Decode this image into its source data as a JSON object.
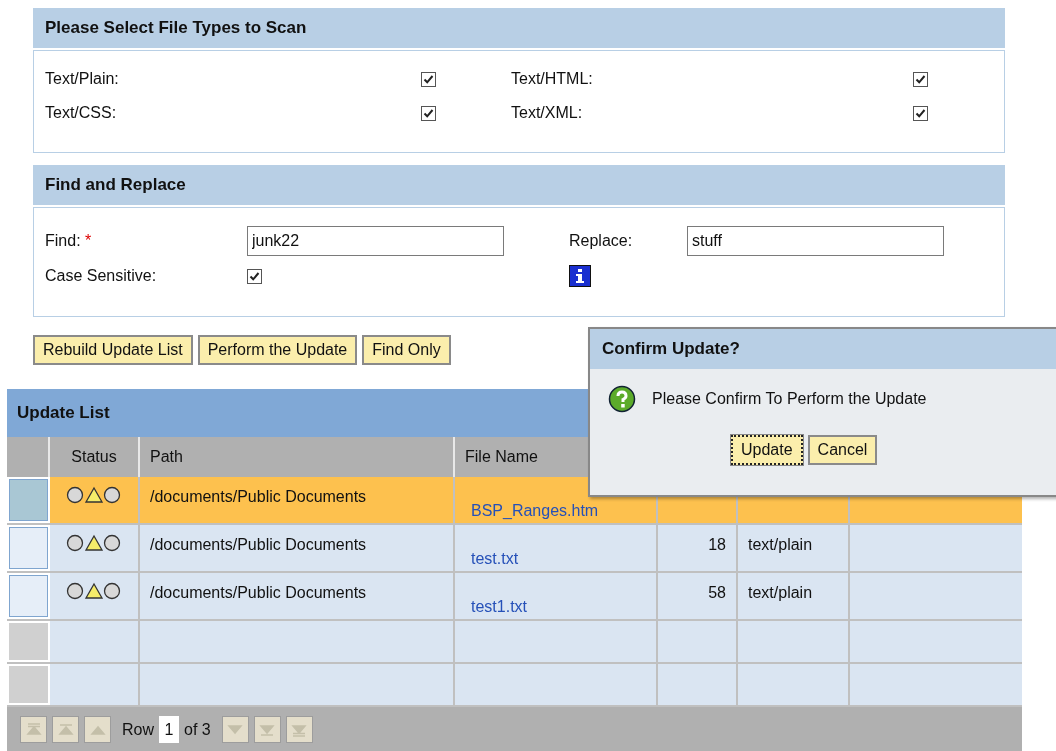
{
  "file_types": {
    "title": "Please Select File Types to Scan",
    "items": [
      {
        "label": "Text/Plain:",
        "checked": true
      },
      {
        "label": "Text/HTML:",
        "checked": true
      },
      {
        "label": "Text/CSS:",
        "checked": true
      },
      {
        "label": "Text/XML:",
        "checked": true
      }
    ]
  },
  "find_replace": {
    "title": "Find and Replace",
    "find_label": "Find:",
    "required_mark": "*",
    "find_value": "junk22",
    "replace_label": "Replace:",
    "replace_value": "stuff",
    "case_label": "Case Sensitive:",
    "case_checked": true
  },
  "actions": [
    "Rebuild Update List",
    "Perform the Update",
    "Find Only"
  ],
  "update_list": {
    "title": "Update List",
    "columns": [
      "Status",
      "Path",
      "File Name"
    ],
    "rows": [
      {
        "kind": "item",
        "selected": true,
        "path": "/documents/Public Documents",
        "file_name": "BSP_Ranges.htm"
      },
      {
        "kind": "item",
        "selected": false,
        "path": "/documents/Public Documents",
        "file_name": "test.txt",
        "column_4": "18",
        "column_5": "text/plain"
      },
      {
        "kind": "item",
        "selected": false,
        "path": "/documents/Public Documents",
        "file_name": "test1.txt",
        "column_4": "58",
        "column_5": "text/plain"
      },
      {
        "kind": "empty"
      },
      {
        "kind": "empty"
      }
    ],
    "pager": {
      "row_label": "Row",
      "current": "1",
      "of_label": "of 3",
      "buttons": [
        {
          "kind": "first",
          "disabled": true
        },
        {
          "kind": "page_up",
          "disabled": true
        },
        {
          "kind": "up",
          "disabled": true
        },
        {
          "kind": "down",
          "disabled": true
        },
        {
          "kind": "page_down",
          "disabled": true
        },
        {
          "kind": "last",
          "disabled": true
        }
      ]
    }
  },
  "dialog": {
    "title": "Confirm Update?",
    "message": "Please Confirm To Perform the Update",
    "buttons": [
      {
        "label": "Update",
        "focused": true
      },
      {
        "label": "Cancel",
        "focused": false
      }
    ]
  }
}
